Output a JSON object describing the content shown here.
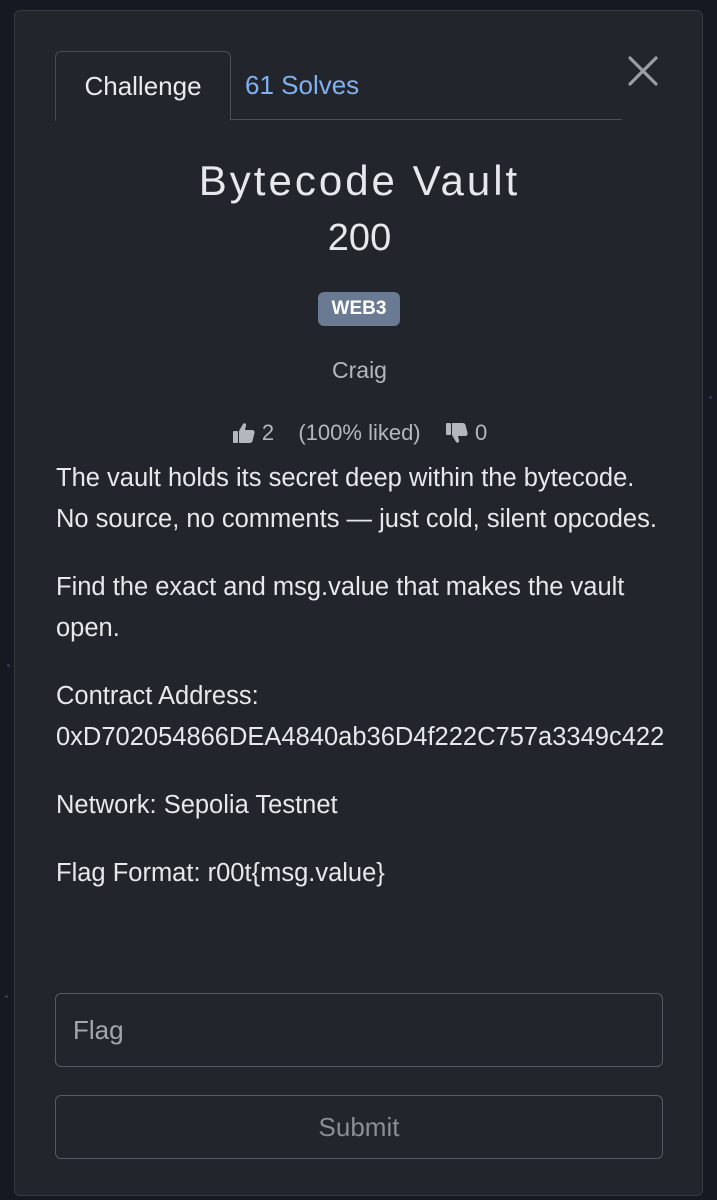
{
  "tabs": {
    "challenge": "Challenge",
    "solves": "61 Solves"
  },
  "challenge": {
    "name": "Bytecode Vault",
    "points": "200",
    "category": "WEB3",
    "author": "Craig"
  },
  "ratings": {
    "likes": "2",
    "liked_pct": "(100% liked)",
    "dislikes": "0"
  },
  "description": {
    "p1": "The vault holds its secret deep within the bytecode. No source, no comments — just cold, silent opcodes.",
    "p2": "Find the exact and msg.value that makes the vault open.",
    "p3_line1": "Contract Address:",
    "p3_line2": "0xD702054866DEA4840ab36D4f222C757a3349c422",
    "p4": "Network: Sepolia Testnet",
    "p5": "Flag Format: r00t{msg.value}"
  },
  "form": {
    "flag_placeholder": "Flag",
    "flag_value": "",
    "submit_label": "Submit"
  },
  "colors": {
    "modal_bg": "#22252b",
    "accent_link": "#7fb1ef",
    "badge_bg": "#6a7a93"
  },
  "icons": {
    "close": "close-icon",
    "like": "thumbs-up-icon",
    "dislike": "thumbs-down-icon"
  }
}
